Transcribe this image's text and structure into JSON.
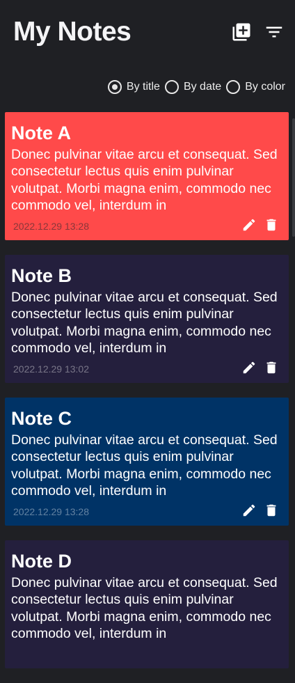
{
  "app": {
    "title": "My Notes"
  },
  "sort": {
    "options": [
      {
        "label": "By title",
        "checked": true
      },
      {
        "label": "By date",
        "checked": false
      },
      {
        "label": "By color",
        "checked": false
      }
    ]
  },
  "notes": [
    {
      "title": "Note A",
      "body": "Donec pulvinar vitae arcu et consequat. Sed consectetur lectus quis enim pulvinar volutpat. Morbi magna enim, commodo nec commodo vel, interdum in",
      "date": "2022.12.29 13:28",
      "color": "#ff4a4a"
    },
    {
      "title": "Note B",
      "body": "Donec pulvinar vitae arcu et consequat. Sed consectetur lectus quis enim pulvinar volutpat. Morbi magna enim, commodo nec commodo vel, interdum in",
      "date": "2022.12.29 13:02",
      "color": "#241f3d"
    },
    {
      "title": "Note C",
      "body": "Donec pulvinar vitae arcu et consequat. Sed consectetur lectus quis enim pulvinar volutpat. Morbi magna enim, commodo nec commodo vel, interdum in",
      "date": "2022.12.29 13:28",
      "color": "#003366"
    },
    {
      "title": "Note D",
      "body": "Donec pulvinar vitae arcu et consequat. Sed consectetur lectus quis enim pulvinar volutpat. Morbi magna enim, commodo nec commodo vel, interdum in",
      "date": "",
      "color": "#241f3d"
    }
  ],
  "icons": {
    "add": "add-note-icon",
    "filter": "filter-icon",
    "edit": "edit-icon",
    "delete": "delete-icon"
  }
}
